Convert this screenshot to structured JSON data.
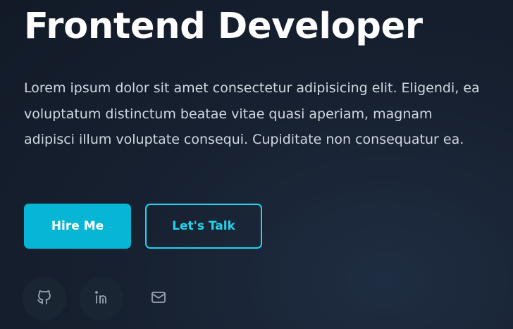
{
  "hero": {
    "title": "Frontend Developer",
    "description": "Lorem ipsum dolor sit amet consectetur adipisicing elit. Eligendi, ea voluptatum distinctum beatae vitae quasi aperiam, magnam adipisci illum voluptate consequi. Cupiditate non consequatur ea."
  },
  "buttons": {
    "primary_label": "Hire Me",
    "secondary_label": "Let's Talk"
  },
  "social": [
    {
      "icon": "github-icon"
    },
    {
      "icon": "linkedin-icon"
    },
    {
      "icon": "mail-icon"
    }
  ],
  "colors": {
    "accent": "#06b6d4",
    "accent_outline": "#22d3ee",
    "background": "#172131",
    "icon": "#9aa3b1"
  }
}
